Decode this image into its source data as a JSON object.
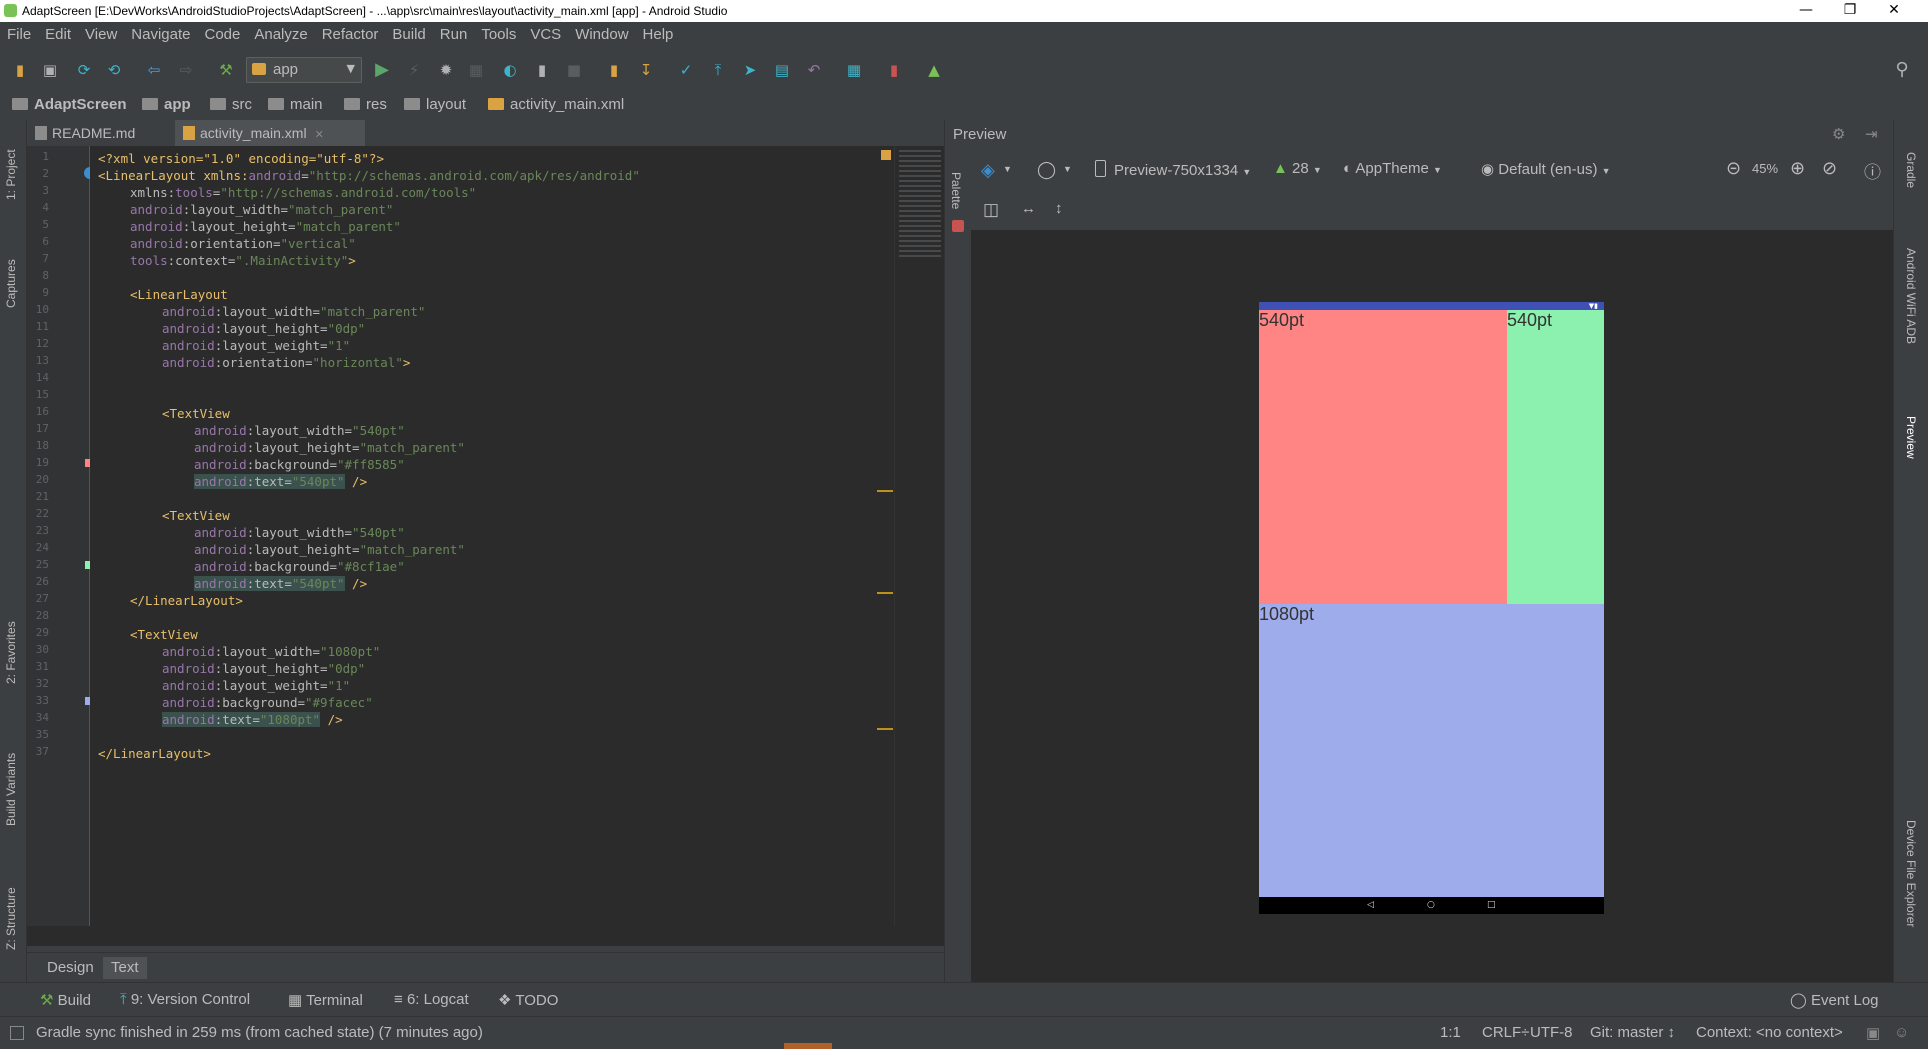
{
  "window": {
    "title": "AdaptScreen [E:\\DevWorks\\AndroidStudioProjects\\AdaptScreen] - ...\\app\\src\\main\\res\\layout\\activity_main.xml [app] - Android Studio",
    "minimize": "—",
    "restore": "❐",
    "close": "✕"
  },
  "menu": [
    "File",
    "Edit",
    "View",
    "Navigate",
    "Code",
    "Analyze",
    "Refactor",
    "Build",
    "Run",
    "Tools",
    "VCS",
    "Window",
    "Help"
  ],
  "toolbar": {
    "run_config": "app"
  },
  "breadcrumb": [
    "AdaptScreen",
    "app",
    "src",
    "main",
    "res",
    "layout",
    "activity_main.xml"
  ],
  "left_tools": {
    "project": "1: Project",
    "captures": "Captures",
    "favorites": "2: Favorites",
    "build_variants": "Build Variants",
    "structure": "Z: Structure"
  },
  "right_tools": {
    "gradle": "Gradle",
    "wifi_adb": "Android WiFi ADB",
    "preview": "Preview",
    "device_explorer": "Device File Explorer"
  },
  "editor": {
    "tabs": [
      "README.md",
      "activity_main.xml"
    ],
    "line_numbers": [
      "1",
      "2",
      "3",
      "4",
      "5",
      "6",
      "7",
      "8",
      "9",
      "10",
      "11",
      "12",
      "13",
      "14",
      "15",
      "16",
      "17",
      "18",
      "19",
      "20",
      "21",
      "22",
      "23",
      "24",
      "25",
      "26",
      "27",
      "28",
      "29",
      "30",
      "31",
      "32",
      "33",
      "34",
      "35",
      "37"
    ],
    "code": {
      "l1": "<?xml version=\"1.0\" encoding=\"utf-8\"?>",
      "l2a": "<LinearLayout xmlns:",
      "l2b": "android",
      "l2c": "=",
      "l2d": "\"http://schemas.android.com/apk/res/android\"",
      "l3a": "xmlns:",
      "l3b": "tools",
      "l3c": "=",
      "l3d": "\"http://schemas.android.com/tools\"",
      "l4a": "android",
      "l4b": ":layout_width=",
      "l4c": "\"match_parent\"",
      "l5a": "android",
      "l5b": ":layout_height=",
      "l5c": "\"match_parent\"",
      "l6a": "android",
      "l6b": ":orientation=",
      "l6c": "\"vertical\"",
      "l7a": "tools",
      "l7b": ":context=",
      "l7c": "\".MainActivity\"",
      "l7d": ">",
      "l9": "<LinearLayout",
      "l10a": "android",
      "l10b": ":layout_width=",
      "l10c": "\"match_parent\"",
      "l11a": "android",
      "l11b": ":layout_height=",
      "l11c": "\"0dp\"",
      "l12a": "android",
      "l12b": ":layout_weight=",
      "l12c": "\"1\"",
      "l13a": "android",
      "l13b": ":orientation=",
      "l13c": "\"horizontal\"",
      "l13d": ">",
      "l16": "<TextView",
      "l17a": "android",
      "l17b": ":layout_width=",
      "l17c": "\"540pt\"",
      "l18a": "android",
      "l18b": ":layout_height=",
      "l18c": "\"match_parent\"",
      "l19a": "android",
      "l19b": ":background=",
      "l19c": "\"#ff8585\"",
      "l20a": "android",
      "l20b": ":text=",
      "l20c": "\"540pt\"",
      "l20d": " />",
      "l22": "<TextView",
      "l23a": "android",
      "l23b": ":layout_width=",
      "l23c": "\"540pt\"",
      "l24a": "android",
      "l24b": ":layout_height=",
      "l24c": "\"match_parent\"",
      "l25a": "android",
      "l25b": ":background=",
      "l25c": "\"#8cf1ae\"",
      "l26a": "android",
      "l26b": ":text=",
      "l26c": "\"540pt\"",
      "l26d": " />",
      "l27": "</LinearLayout>",
      "l29": "<TextView",
      "l30a": "android",
      "l30b": ":layout_width=",
      "l30c": "\"1080pt\"",
      "l31a": "android",
      "l31b": ":layout_height=",
      "l31c": "\"0dp\"",
      "l32a": "android",
      "l32b": ":layout_weight=",
      "l32c": "\"1\"",
      "l33a": "android",
      "l33b": ":background=",
      "l33c": "\"#9facec\"",
      "l34a": "android",
      "l34b": ":text=",
      "l34c": "\"1080pt\"",
      "l34d": " />",
      "l37": "</LinearLayout>"
    },
    "design_tabs": [
      "Design",
      "Text"
    ],
    "palette": "Palette"
  },
  "preview": {
    "title": "Preview",
    "device": "Preview-750x1334",
    "api": "28",
    "theme": "AppTheme",
    "locale": "Default (en-us)",
    "zoom": "45%",
    "views": {
      "tv1": "540pt",
      "tv2": "540pt",
      "tv3": "1080pt"
    },
    "colors": {
      "tv1": "#ff8585",
      "tv2": "#8cf1ae",
      "tv3": "#9facec"
    }
  },
  "bottom_tools": {
    "build": "Build",
    "vcs": "9: Version Control",
    "terminal": "Terminal",
    "logcat": "6: Logcat",
    "todo": "TODO",
    "event_log": "Event Log"
  },
  "status": {
    "message": "Gradle sync finished in 259 ms (from cached state) (7 minutes ago)",
    "position": "1:1",
    "line_sep": "CRLF÷",
    "encoding": "UTF-8",
    "git": "Git: master ↕",
    "context": "Context: <no context>"
  }
}
